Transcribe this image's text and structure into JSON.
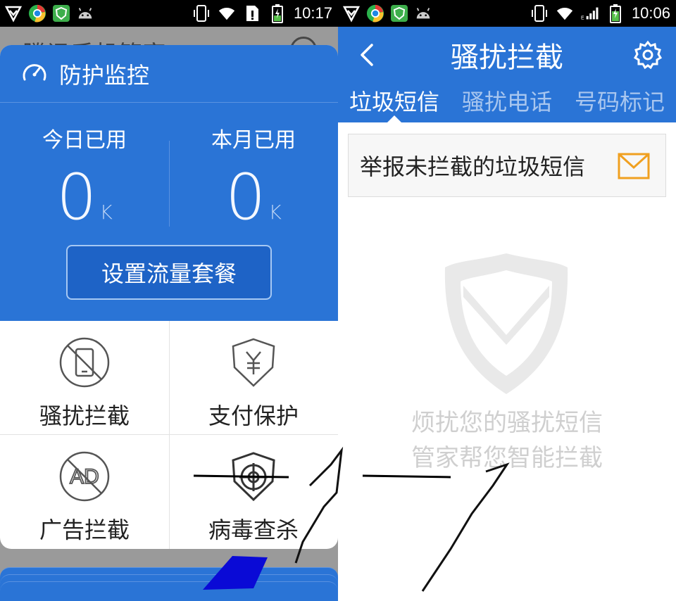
{
  "left_screen": {
    "status_bar": {
      "time": "10:17"
    },
    "background_title": "腾讯手机管家",
    "popup": {
      "title": "防护监控",
      "today": {
        "label": "今日已用",
        "value": "0",
        "unit": "K"
      },
      "month": {
        "label": "本月已用",
        "value": "0",
        "unit": "K"
      },
      "set_plan_button": "设置流量套餐",
      "features": [
        {
          "label": "骚扰拦截",
          "icon": "no-phone-icon"
        },
        {
          "label": "支付保护",
          "icon": "yuan-shield-icon"
        },
        {
          "label": "广告拦截",
          "icon": "no-ad-icon"
        },
        {
          "label": "病毒查杀",
          "icon": "target-shield-icon"
        }
      ]
    }
  },
  "right_screen": {
    "status_bar": {
      "time": "10:06"
    },
    "app_bar": {
      "title": "骚扰拦截"
    },
    "tabs": [
      {
        "label": "垃圾短信",
        "active": true
      },
      {
        "label": "骚扰电话",
        "active": false
      },
      {
        "label": "号码标记",
        "active": false
      }
    ],
    "report_card": {
      "label": "举报未拦截的垃圾短信"
    },
    "empty_state": {
      "line1": "烦扰您的骚扰短信",
      "line2": "管家帮您智能拦截"
    }
  },
  "colors": {
    "primary_blue": "#2a74d6",
    "mail_orange": "#f0a020"
  }
}
